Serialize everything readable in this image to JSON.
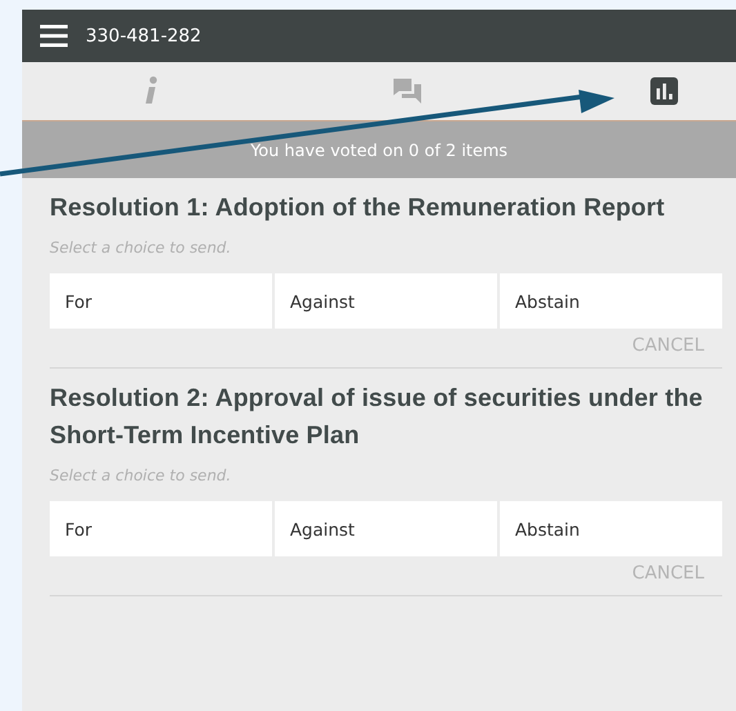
{
  "header": {
    "title": "330-481-282"
  },
  "tabs": [
    {
      "kind": "info",
      "selected": false
    },
    {
      "kind": "chat",
      "selected": false
    },
    {
      "kind": "poll",
      "selected": true
    }
  ],
  "banner": "You have voted on 0 of 2 items",
  "resolutions": [
    {
      "title": "Resolution 1: Adoption of the Remuneration Report",
      "hint": "Select a choice to send.",
      "choices": [
        {
          "label": "For",
          "selected": false
        },
        {
          "label": "Against",
          "selected": false
        },
        {
          "label": "Abstain",
          "selected": false
        }
      ],
      "cancel": "CANCEL"
    },
    {
      "title": "Resolution 2: Approval of issue of securities under the Short-Term Incentive Plan",
      "hint": "Select a choice to send.",
      "choices": [
        {
          "label": "For",
          "selected": false
        },
        {
          "label": "Against",
          "selected": false
        },
        {
          "label": "Abstain",
          "selected": false
        }
      ],
      "cancel": "CANCEL"
    }
  ]
}
